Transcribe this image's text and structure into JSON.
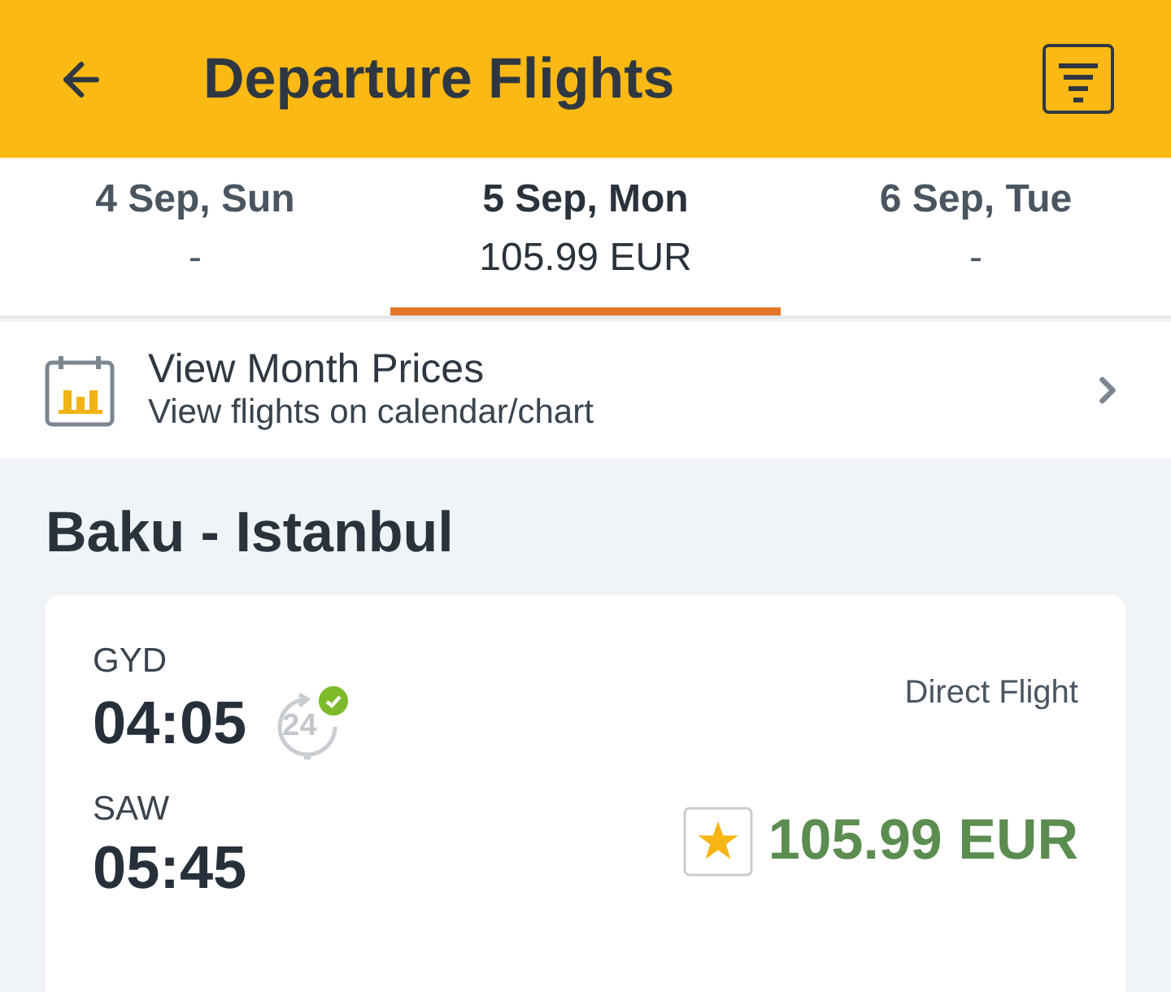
{
  "header": {
    "title": "Departure Flights"
  },
  "date_tabs": [
    {
      "date": "4 Sep, Sun",
      "price": "-",
      "selected": false
    },
    {
      "date": "5 Sep, Mon",
      "price": "105.99 EUR",
      "selected": true
    },
    {
      "date": "6 Sep, Tue",
      "price": "-",
      "selected": false
    }
  ],
  "month_prices": {
    "title": "View Month Prices",
    "subtitle": "View flights on calendar/chart"
  },
  "route": {
    "title": "Baku - Istanbul"
  },
  "flights": [
    {
      "departure_code": "GYD",
      "departure_time": "04:05",
      "flexible_hours": "24",
      "arrival_code": "SAW",
      "arrival_time": "05:45",
      "flight_type": "Direct Flight",
      "price": "105.99 EUR"
    }
  ]
}
